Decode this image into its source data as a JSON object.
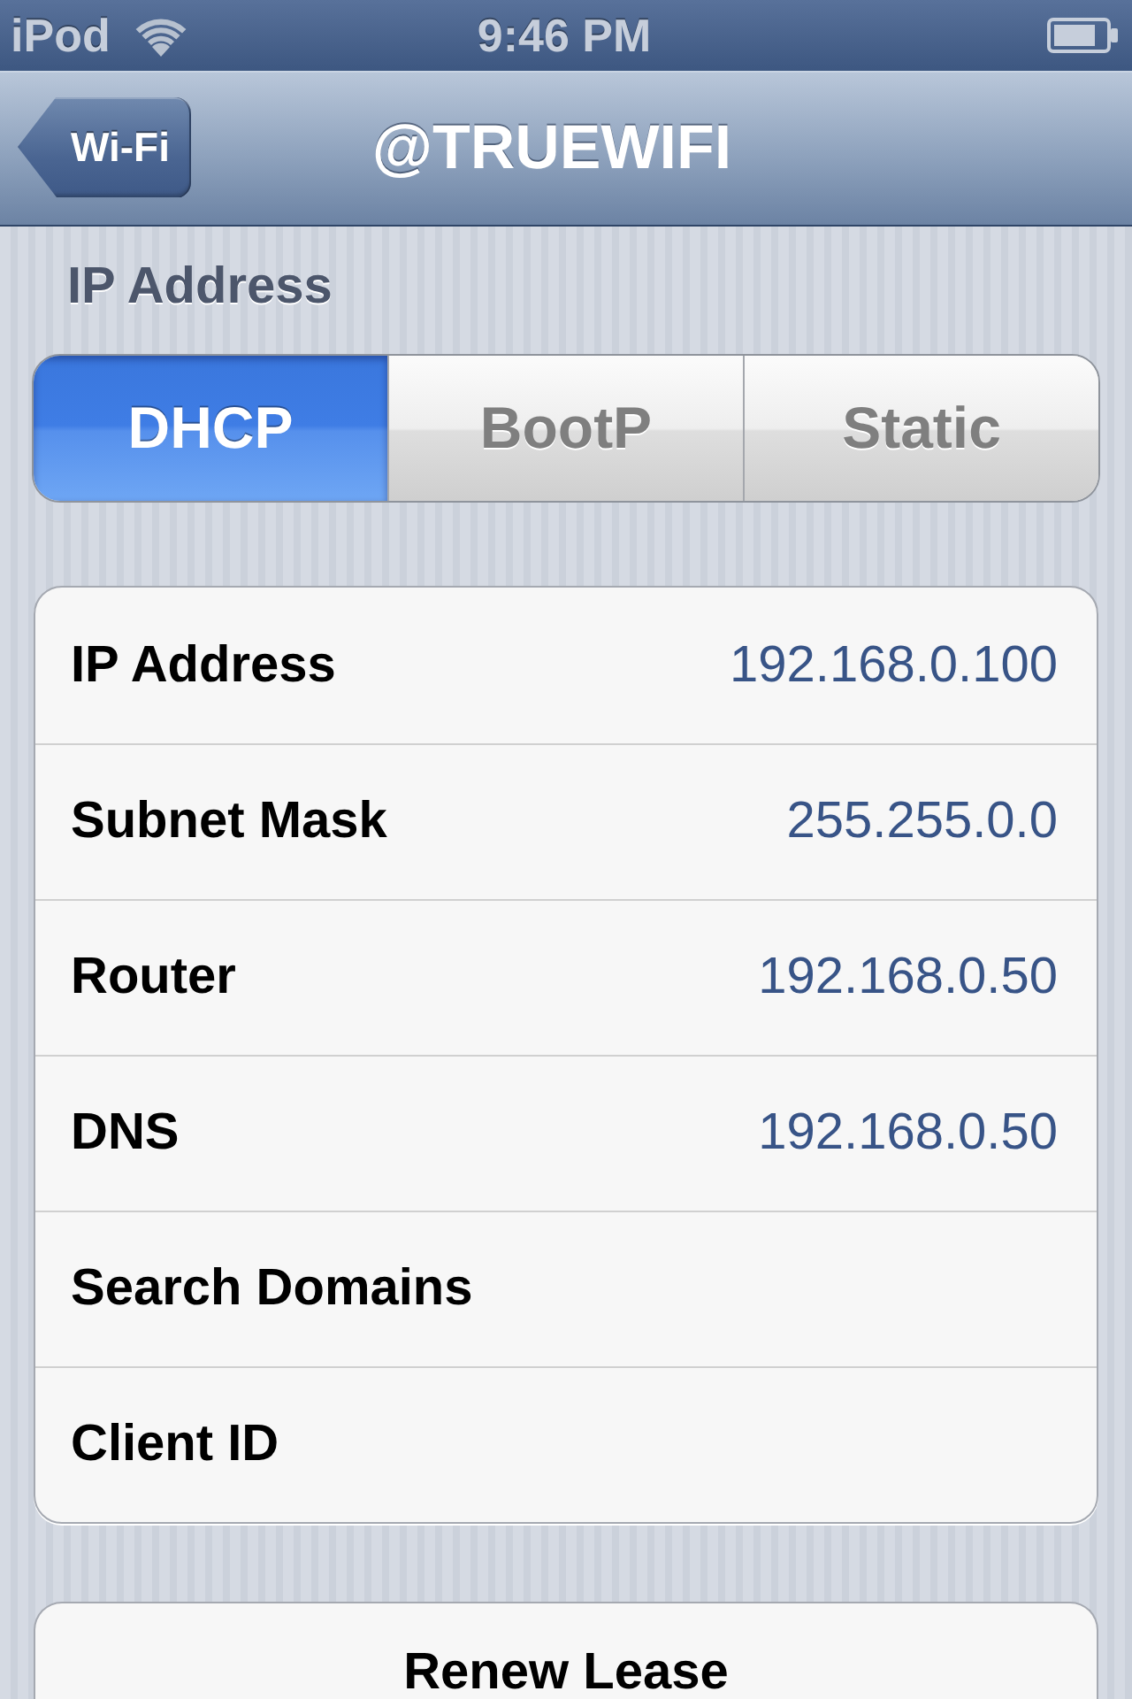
{
  "status_bar": {
    "carrier": "iPod",
    "time": "9:46 PM"
  },
  "nav_bar": {
    "back_button": "Wi-Fi",
    "title": "@TRUEWIFI"
  },
  "section_header": "IP Address",
  "segments": [
    {
      "label": "DHCP",
      "selected": true
    },
    {
      "label": "BootP",
      "selected": false
    },
    {
      "label": "Static",
      "selected": false
    }
  ],
  "fields": [
    {
      "label": "IP Address",
      "value": "192.168.0.100"
    },
    {
      "label": "Subnet Mask",
      "value": "255.255.0.0"
    },
    {
      "label": "Router",
      "value": "192.168.0.50"
    },
    {
      "label": "DNS",
      "value": "192.168.0.50"
    },
    {
      "label": "Search Domains"
    },
    {
      "label": "Client ID"
    }
  ],
  "renew_button": "Renew Lease"
}
